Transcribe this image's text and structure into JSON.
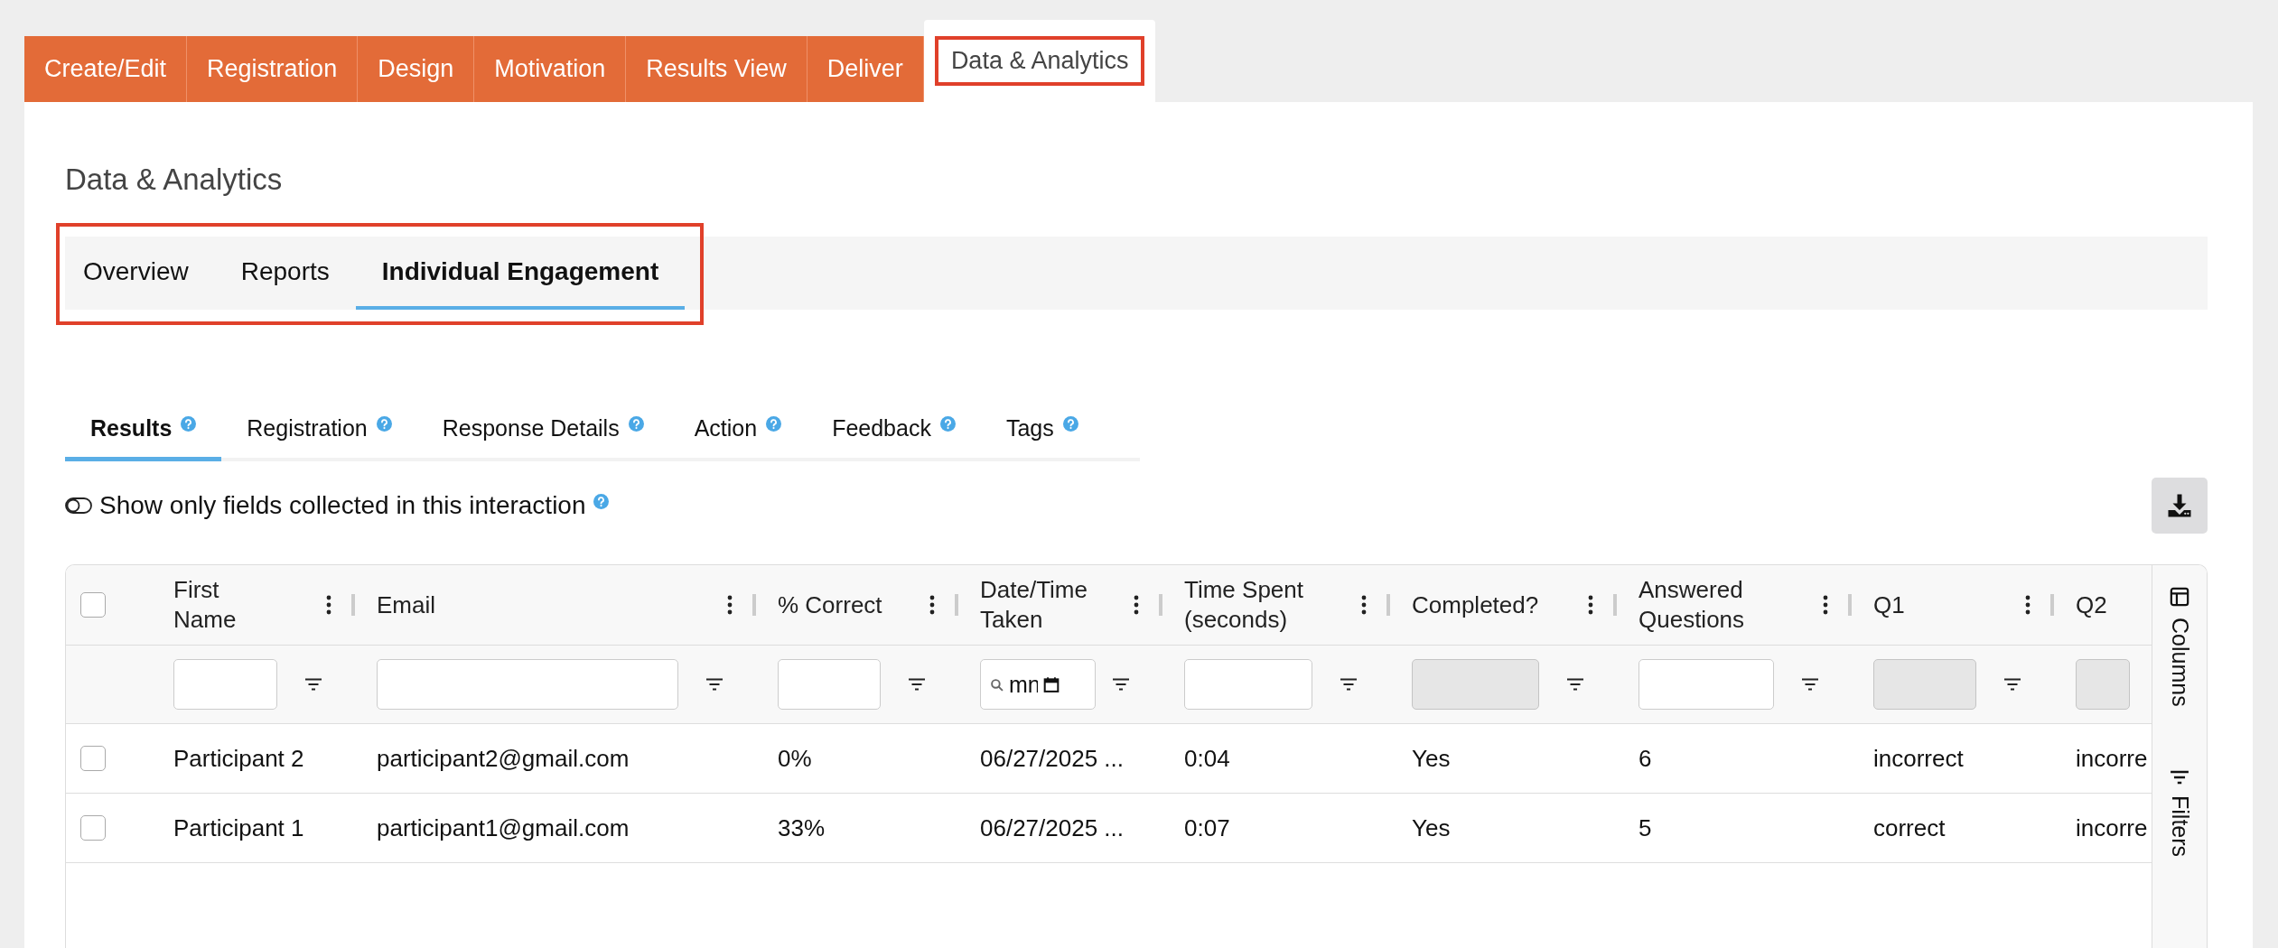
{
  "tabs": [
    {
      "label": "Create/Edit",
      "selected": false,
      "highlighted": false
    },
    {
      "label": "Registration",
      "selected": false,
      "highlighted": false
    },
    {
      "label": "Design",
      "selected": false,
      "highlighted": false
    },
    {
      "label": "Motivation",
      "selected": false,
      "highlighted": false
    },
    {
      "label": "Results View",
      "selected": false,
      "highlighted": false
    },
    {
      "label": "Deliver",
      "selected": false,
      "highlighted": false
    },
    {
      "label": "Data & Analytics",
      "selected": true,
      "highlighted": true
    }
  ],
  "page_title": "Data & Analytics",
  "view_tabs": {
    "highlighted": true,
    "items": [
      {
        "label": "Overview",
        "selected": false
      },
      {
        "label": "Reports",
        "selected": false
      },
      {
        "label": "Individual Engagement",
        "selected": true
      }
    ]
  },
  "section_tabs": [
    {
      "label": "Results",
      "selected": true
    },
    {
      "label": "Registration",
      "selected": false
    },
    {
      "label": "Response Details",
      "selected": false
    },
    {
      "label": "Action",
      "selected": false
    },
    {
      "label": "Feedback",
      "selected": false
    },
    {
      "label": "Tags",
      "selected": false
    }
  ],
  "toggle": {
    "label": "Show only fields collected in this interaction",
    "on": false
  },
  "table": {
    "select_all_checked": false,
    "columns": [
      {
        "label": "First Name",
        "filter": {
          "disabled": false
        }
      },
      {
        "label": "Email",
        "filter": {
          "disabled": false
        }
      },
      {
        "label": "% Correct",
        "filter": {
          "disabled": false
        }
      },
      {
        "label": "Date/Time Taken",
        "filter": {
          "disabled": false,
          "kind": "date",
          "value": "mn"
        }
      },
      {
        "label": "Time Spent (seconds)",
        "filter": {
          "disabled": false
        }
      },
      {
        "label": "Completed?",
        "filter": {
          "disabled": true
        }
      },
      {
        "label": "Answered Questions",
        "filter": {
          "disabled": false
        }
      },
      {
        "label": "Q1",
        "filter": {
          "disabled": true
        }
      },
      {
        "label": "Q2",
        "filter": {
          "disabled": true
        }
      }
    ],
    "rows": [
      {
        "checked": false,
        "cells": [
          "Participant 2",
          "participant2@gmail.com",
          "0%",
          "06/27/2025 ...",
          "0:04",
          "Yes",
          "6",
          "incorrect",
          "incorre"
        ]
      },
      {
        "checked": false,
        "cells": [
          "Participant 1",
          "participant1@gmail.com",
          "33%",
          "06/27/2025 ...",
          "0:07",
          "Yes",
          "5",
          "correct",
          "incorre"
        ]
      }
    ]
  },
  "side_panel": [
    "Columns",
    "Filters"
  ]
}
